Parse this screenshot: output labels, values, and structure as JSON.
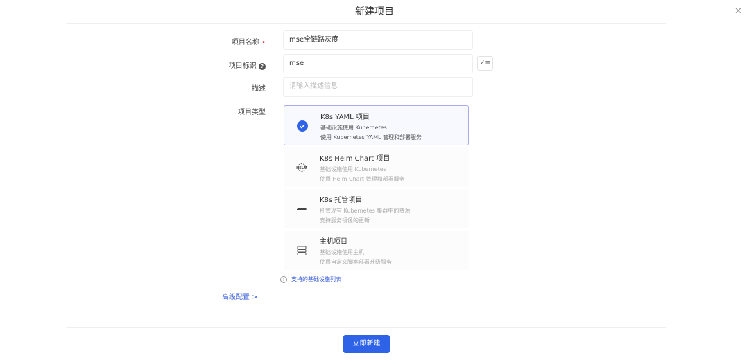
{
  "dialog": {
    "title": "新建项目",
    "close_icon": "close-icon"
  },
  "form": {
    "name": {
      "label": "项目名称",
      "value": "mse全链路灰度",
      "required_mark": "•"
    },
    "key": {
      "label": "项目标识",
      "value": "mse",
      "help_icon": "?"
    },
    "description": {
      "label": "描述",
      "placeholder": "请输入描述信息"
    },
    "type": {
      "label": "项目类型",
      "options": [
        {
          "title": "K8s YAML 项目",
          "line1": "基础设施使用 Kubernetes",
          "line2": "使用 Kubernetes YAML 管理和部署服务",
          "selected": true,
          "icon": "check-circle-icon"
        },
        {
          "title": "K8s Helm Chart 项目",
          "line1": "基础设施使用 Kubernetes",
          "line2": "使用 Helm Chart 管理和部署服务",
          "selected": false,
          "icon": "helm-icon"
        },
        {
          "title": "K8s 托管项目",
          "line1": "托管现有 Kubernetes 集群中的资源",
          "line2": "支持服务镜像的更新",
          "selected": false,
          "icon": "hand-icon"
        },
        {
          "title": "主机项目",
          "line1": "基础设施使用主机",
          "line2": "使用自定义脚本部署升级服务",
          "selected": false,
          "icon": "server-icon"
        }
      ]
    },
    "infra_link": "支持的基础设施列表",
    "advanced": "高级配置",
    "advanced_chevron": ">"
  },
  "footer": {
    "submit": "立即新建"
  },
  "colors": {
    "primary": "#2e63e8",
    "required": "#e02020",
    "selected_border": "#a9acef"
  }
}
